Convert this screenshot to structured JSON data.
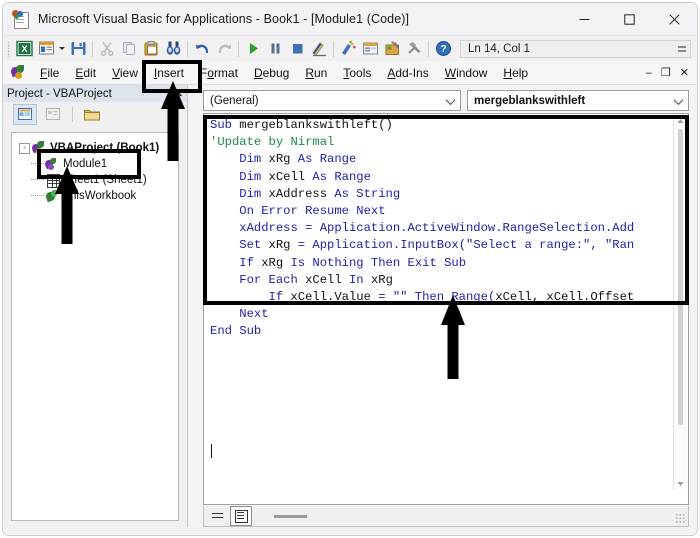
{
  "window": {
    "title": "Microsoft Visual Basic for Applications - Book1 - [Module1 (Code)]",
    "icon": "vba-app-icon",
    "minimize": "–",
    "maximize": "☐",
    "close": "✕"
  },
  "toolbar": {
    "items": [
      {
        "name": "view-excel-icon",
        "glyph": "X"
      },
      {
        "name": "insert-userform-icon",
        "glyph": ""
      },
      {
        "name": "insert-dropdown-arrow",
        "glyph": ""
      },
      {
        "name": "save-icon",
        "glyph": ""
      },
      {
        "name": "cut-icon",
        "glyph": ""
      },
      {
        "name": "copy-icon",
        "glyph": ""
      },
      {
        "name": "paste-icon",
        "glyph": ""
      },
      {
        "name": "find-icon",
        "glyph": ""
      },
      {
        "name": "undo-icon",
        "glyph": ""
      },
      {
        "name": "redo-icon",
        "glyph": ""
      },
      {
        "name": "run-icon",
        "glyph": ""
      },
      {
        "name": "pause-icon",
        "glyph": ""
      },
      {
        "name": "stop-icon",
        "glyph": ""
      },
      {
        "name": "design-mode-icon",
        "glyph": ""
      },
      {
        "name": "project-explorer-icon",
        "glyph": ""
      },
      {
        "name": "properties-window-icon",
        "glyph": ""
      },
      {
        "name": "object-browser-icon",
        "glyph": ""
      },
      {
        "name": "toolbox-icon",
        "glyph": ""
      },
      {
        "name": "help-icon",
        "glyph": "?"
      }
    ],
    "status_text": "Ln 14, Col 1"
  },
  "menubar": {
    "icon": "vba-logo-icon",
    "items": [
      {
        "label": "File",
        "accel": "F"
      },
      {
        "label": "Edit",
        "accel": "E"
      },
      {
        "label": "View",
        "accel": "V"
      },
      {
        "label": "Insert",
        "accel": "I"
      },
      {
        "label": "Format",
        "accel": "o"
      },
      {
        "label": "Debug",
        "accel": "D"
      },
      {
        "label": "Run",
        "accel": "R"
      },
      {
        "label": "Tools",
        "accel": "T"
      },
      {
        "label": "Add-Ins",
        "accel": "A"
      },
      {
        "label": "Window",
        "accel": "W"
      },
      {
        "label": "Help",
        "accel": "H"
      }
    ],
    "mdi_minimize": "–",
    "mdi_restore": "❐",
    "mdi_close": "✕"
  },
  "project_explorer": {
    "title": "Project - VBAProject",
    "close_label": "✕",
    "toolbar": [
      {
        "name": "view-code-button"
      },
      {
        "name": "view-object-button"
      },
      {
        "name": "toggle-folders-button"
      }
    ],
    "tree": [
      {
        "label": "VBAProject (Book1)",
        "icon": "vba-project-icon",
        "level": 0,
        "expander": "-"
      },
      {
        "label": "Module1",
        "icon": "module-icon",
        "level": 1
      },
      {
        "label": "Sheet1 (Sheet1)",
        "icon": "sheet-icon",
        "level": 1
      },
      {
        "label": "ThisWorkbook",
        "icon": "workbook-icon",
        "level": 1
      }
    ]
  },
  "code_window": {
    "object_dropdown": "(General)",
    "procedure_dropdown": "mergeblankswithleft",
    "code_lines": [
      {
        "indent": 0,
        "parts": [
          {
            "t": "kw",
            "s": "Sub"
          },
          {
            "t": "id",
            "s": " mergeblankswithleft()"
          }
        ]
      },
      {
        "indent": 0,
        "parts": [
          {
            "t": "cm",
            "s": "'Update by Nirmal"
          }
        ]
      },
      {
        "indent": 1,
        "parts": [
          {
            "t": "kw",
            "s": "Dim"
          },
          {
            "t": "id",
            "s": " xRg "
          },
          {
            "t": "kw",
            "s": "As Range"
          }
        ]
      },
      {
        "indent": 1,
        "parts": [
          {
            "t": "kw",
            "s": "Dim"
          },
          {
            "t": "id",
            "s": " xCell "
          },
          {
            "t": "kw",
            "s": "As Range"
          }
        ]
      },
      {
        "indent": 1,
        "parts": [
          {
            "t": "kw",
            "s": "Dim"
          },
          {
            "t": "id",
            "s": " xAddress "
          },
          {
            "t": "kw",
            "s": "As String"
          }
        ]
      },
      {
        "indent": 1,
        "parts": [
          {
            "t": "kw",
            "s": "On Error Resume Next"
          }
        ]
      },
      {
        "indent": 1,
        "parts": [
          {
            "t": "kw",
            "s": "xAddress = Application.ActiveWindow.RangeSelection.Add"
          }
        ]
      },
      {
        "indent": 1,
        "parts": [
          {
            "t": "kw",
            "s": "Set"
          },
          {
            "t": "id",
            "s": " xRg "
          },
          {
            "t": "kw",
            "s": "= Application.InputBox(\"Select a range:\", \"Ran"
          }
        ]
      },
      {
        "indent": 1,
        "parts": [
          {
            "t": "kw",
            "s": "If"
          },
          {
            "t": "id",
            "s": " xRg "
          },
          {
            "t": "kw",
            "s": "Is Nothing Then Exit Sub"
          }
        ]
      },
      {
        "indent": 1,
        "parts": [
          {
            "t": "kw",
            "s": "For Each"
          },
          {
            "t": "id",
            "s": " xCell "
          },
          {
            "t": "kw",
            "s": "In"
          },
          {
            "t": "id",
            "s": " xRg"
          }
        ]
      },
      {
        "indent": 2,
        "parts": [
          {
            "t": "kw",
            "s": "If"
          },
          {
            "t": "id",
            "s": " xCell.Value "
          },
          {
            "t": "kw",
            "s": "= \"\" Then Range("
          },
          {
            "t": "id",
            "s": "xCell, xCell.Offset"
          }
        ]
      },
      {
        "indent": 1,
        "parts": [
          {
            "t": "kw",
            "s": "Next"
          }
        ]
      },
      {
        "indent": 0,
        "parts": [
          {
            "t": "kw",
            "s": "End Sub"
          }
        ]
      }
    ],
    "full_code_text": "Sub mergeblankswithleft()\n'Update by Nirmal\n    Dim xRg As Range\n    Dim xCell As Range\n    Dim xAddress As String\n    On Error Resume Next\n    xAddress = Application.ActiveWindow.RangeSelection.Add\n    Set xRg = Application.InputBox(\"Select a range:\", \"Ran\n    If xRg Is Nothing Then Exit Sub\n    For Each xCell In xRg\n        If xCell.Value = \"\" Then Range(xCell, xCell.Offset\n    Next\nEnd Sub",
    "footer": {
      "procedure_view_button": "procedure-view",
      "full_module_view_button": "full-module-view"
    }
  },
  "annotations": [
    {
      "name": "insert-menu-highlight",
      "type": "rect"
    },
    {
      "name": "module1-highlight",
      "type": "rect"
    },
    {
      "name": "code-block-highlight",
      "type": "rect"
    },
    {
      "name": "arrow-to-insert",
      "type": "arrow-up"
    },
    {
      "name": "arrow-to-module1",
      "type": "arrow-up"
    },
    {
      "name": "arrow-to-code",
      "type": "arrow-up"
    }
  ],
  "colors": {
    "keyword": "#1f1fa8",
    "comment": "#1d8a4c",
    "identifier": "#111111",
    "annotation": "#000000",
    "titlebar": "#f3f3f7",
    "panel_header": "#dde4ee"
  }
}
